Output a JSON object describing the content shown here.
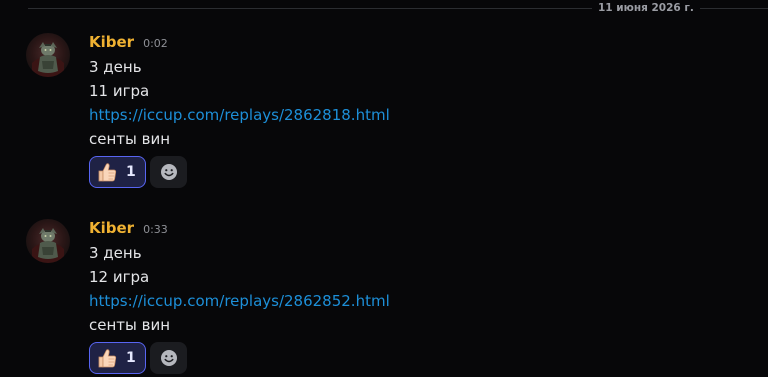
{
  "date_divider": "11 июня 2026 г.",
  "messages": [
    {
      "author": "Kiber",
      "time": "0:02",
      "lines": [
        "3 день",
        "11 игра"
      ],
      "link": "https://iccup.com/replays/2862818.html",
      "after_link": "сенты вин",
      "reaction": {
        "emoji": "thumbs-up-icon",
        "count": "1"
      }
    },
    {
      "author": "Kiber",
      "time": "0:33",
      "lines": [
        "3 день",
        "12 игра"
      ],
      "link": "https://iccup.com/replays/2862852.html",
      "after_link": "сенты вин",
      "reaction": {
        "emoji": "thumbs-up-icon",
        "count": "1"
      }
    }
  ],
  "colors": {
    "background": "#070709",
    "author": "#f0b232",
    "link": "#1d8fd8",
    "reaction_active_bg": "#1f2245",
    "reaction_active_border": "#5865f2"
  }
}
